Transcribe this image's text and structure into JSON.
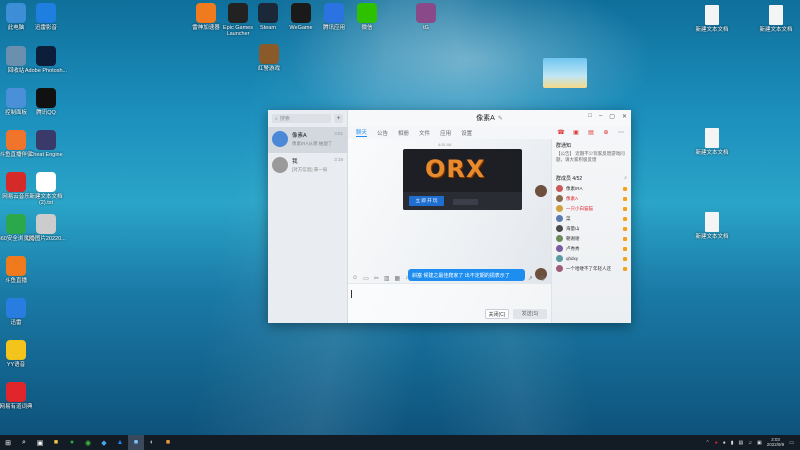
{
  "desktop": {
    "left_icons": [
      {
        "label": "此电脑",
        "icon": "computer-icon",
        "color": "#3c8fd6"
      },
      {
        "label": "迅雷影音",
        "icon": "xunlei-player-icon",
        "color": "#1f7fe0"
      },
      {
        "label": "回收站",
        "icon": "recycle-bin-icon",
        "color": "#6b8fae"
      },
      {
        "label": "Adobe Photosh...",
        "icon": "photoshop-icon",
        "color": "#0c1e3a"
      },
      {
        "label": "控制面板",
        "icon": "control-panel-icon",
        "color": "#4a90d9"
      },
      {
        "label": "腾讯QQ",
        "icon": "qq-icon",
        "color": "#111111"
      },
      {
        "label": "斗鱼直播伴侣",
        "icon": "douyu-icon",
        "color": "#f0742a"
      },
      {
        "label": "Cheat Engine",
        "icon": "cheat-engine-icon",
        "color": "#3a3a6a"
      },
      {
        "label": "网易云音乐",
        "icon": "netease-music-icon",
        "color": "#d62a2a"
      },
      {
        "label": "新建文本文档 (2).txt",
        "icon": "text-file-icon",
        "color": "#ffffff"
      },
      {
        "label": "360安全浏览器",
        "icon": "360-browser-icon",
        "color": "#2ca84c"
      },
      {
        "label": "QQ图片20220...",
        "icon": "image-file-icon",
        "color": "#cccccc"
      },
      {
        "label": "斗鱼直播",
        "icon": "douyu-live-icon",
        "color": "#f07b1e"
      },
      {
        "label": "迅雷",
        "icon": "xunlei-icon",
        "color": "#2a7de0"
      },
      {
        "label": "YY语音",
        "icon": "yy-icon",
        "color": "#f2c41c"
      },
      {
        "label": "网易有道词典",
        "icon": "youdao-icon",
        "color": "#e0262b"
      }
    ],
    "top_icons": [
      {
        "label": "雷神加速器",
        "icon": "leishen-icon",
        "color": "#f07a1e"
      },
      {
        "label": "Epic Games Launcher",
        "icon": "epic-games-icon",
        "color": "#222222"
      },
      {
        "label": "Steam",
        "icon": "steam-icon",
        "color": "#1b2838"
      },
      {
        "label": "WeGame",
        "icon": "wegame-icon",
        "color": "#1a1a1a"
      },
      {
        "label": "腾讯应用",
        "icon": "tencent-app-icon",
        "color": "#2a73e0"
      },
      {
        "label": "微信",
        "icon": "wechat-icon",
        "color": "#2dc100"
      },
      {
        "label": "tG",
        "icon": "winrar-icon",
        "color": "#8a4a8a"
      },
      {
        "label": "红警游戏",
        "icon": "red-alert-icon",
        "color": "#8a5a2a"
      }
    ],
    "right_icons": [
      {
        "label": "新建文本文档",
        "icon": "text-file-icon"
      },
      {
        "label": "新建文本文档",
        "icon": "text-file-icon"
      },
      {
        "label": "新建文本文档",
        "icon": "text-file-icon"
      },
      {
        "label": "新建文本文档",
        "icon": "text-file-icon"
      }
    ]
  },
  "qq": {
    "title": "像素A",
    "search_placeholder": "搜索",
    "conversations": [
      {
        "name": "像素A",
        "time": "3:51",
        "preview": "像素IRA从哪  抽烟了",
        "avatar_color": "#4b88d8"
      },
      {
        "name": "我",
        "time": "3:18",
        "preview": "[对方信息]  来一局",
        "avatar_color": "#9a9a9a"
      }
    ],
    "tabs": [
      "聊天",
      "公告",
      "相册",
      "文件",
      "应用",
      "设置"
    ],
    "active_tab": "聊天",
    "chat": {
      "timestamp": "4:51:08",
      "image_logo": "ORX",
      "image_button": "立 即 开 玩",
      "text_message": "斜塞  候建之最佳爬家了  出不定期的捐表示了"
    },
    "buttons": {
      "close": "关闭(C)",
      "send": "发送(S)"
    },
    "sidebar": {
      "notice_title": "群通知",
      "notice_text": "【公告】 近期不少玩家反馈游戏问题，请大家积极反馈",
      "members_title": "群成员",
      "members_count": "4/52",
      "members": [
        {
          "name": "像素IRA",
          "color": "#333333"
        },
        {
          "name": "像素A",
          "color": "#e0262b"
        },
        {
          "name": "一只小白猫猫",
          "color": "#e0262b"
        },
        {
          "name": "菜",
          "color": "#333333"
        },
        {
          "name": "海量山",
          "color": "#333333"
        },
        {
          "name": "朝谢谢",
          "color": "#333333"
        },
        {
          "name": "卢秀秀",
          "color": "#333333"
        },
        {
          "name": "qhdxy",
          "color": "#333333"
        },
        {
          "name": "一个哈喽不了年轻人还",
          "color": "#333333"
        }
      ]
    }
  },
  "taskbar": {
    "time": "3:03",
    "date": "2022/9/9"
  }
}
